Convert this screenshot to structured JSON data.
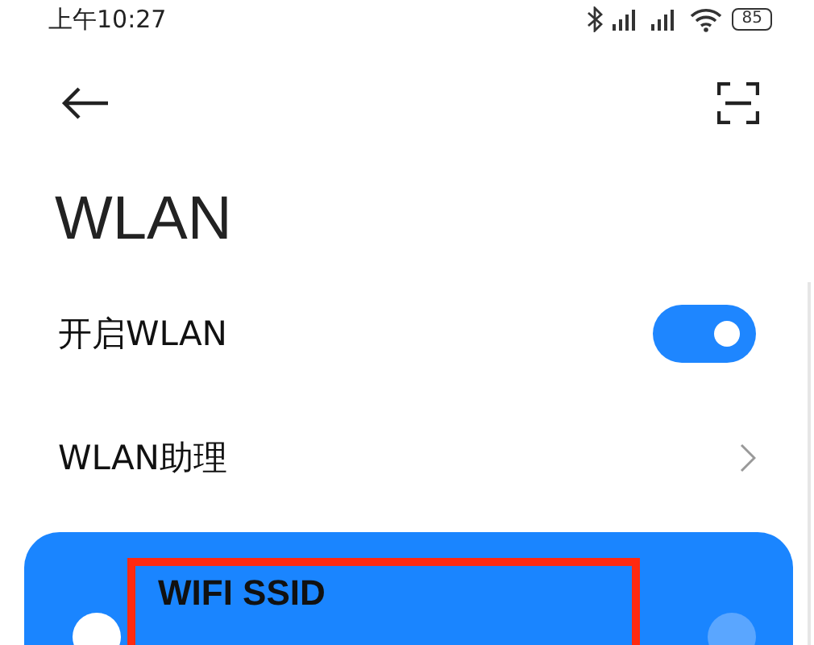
{
  "status_bar": {
    "time": "上午10:27",
    "battery": "85"
  },
  "header": {
    "title": "WLAN"
  },
  "settings": [
    {
      "kind": "toggle",
      "label": "开启WLAN",
      "on": true
    },
    {
      "kind": "link",
      "label": "WLAN助理"
    }
  ],
  "connected_network": {
    "ssid": "WIFI SSID",
    "highlighted": true
  }
}
